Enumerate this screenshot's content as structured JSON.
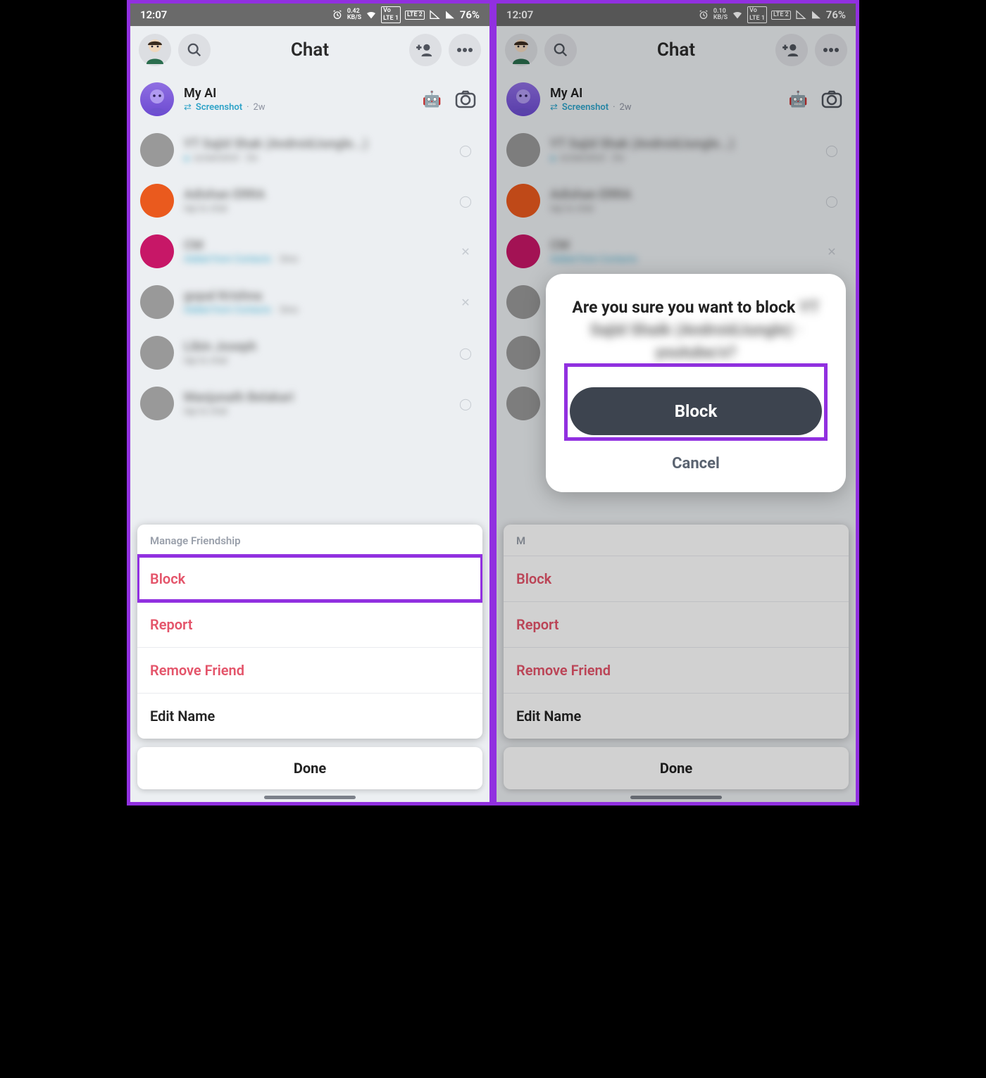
{
  "status": {
    "time": "12:07",
    "kbs_left": "0.42",
    "kbs_unit": "KB/S",
    "kbs_right": "0.10",
    "lte1": "LTE 1",
    "lte2": "LTE 2",
    "vo": "Vo",
    "battery": "76%"
  },
  "header": {
    "title": "Chat"
  },
  "first_row": {
    "name": "My AI",
    "sub_label": "Screenshot",
    "sub_time": "2w"
  },
  "sheet": {
    "title": "Manage Friendship",
    "block": "Block",
    "report": "Report",
    "remove": "Remove Friend",
    "edit": "Edit Name",
    "done": "Done"
  },
  "modal": {
    "line": "Are you sure you want to block",
    "block_btn": "Block",
    "cancel": "Cancel"
  }
}
